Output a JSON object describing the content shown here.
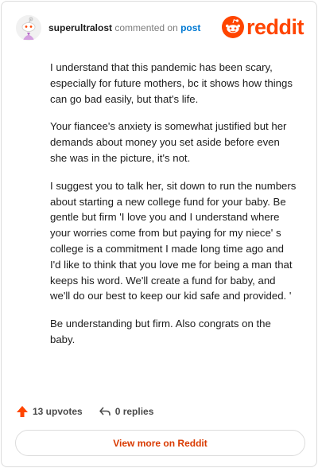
{
  "comment": {
    "author": "superultralost",
    "action_text": "commented on",
    "post_link": "post",
    "paragraphs": [
      "I understand that this pandemic has been scary, especially for future mothers, bc it shows how things can go bad easily, but that's life.",
      "Your fiancee's anxiety is somewhat justified but her demands about money you set aside before even she was in the picture, it's not.",
      "I suggest you to talk her, sit down to run the numbers about starting a new college fund for your baby. Be gentle but firm 'I love you and I understand where your worries come from but paying for my niece' s college is a commitment I made long time ago and I'd like to think that you love me for being a man that keeps his word. We'll create a fund for baby, and we'll do our best to keep our kid safe and provided. '",
      "Be understanding but firm. Also congrats on the baby."
    ]
  },
  "brand": {
    "wordmark": "reddit",
    "color": "#ff4500"
  },
  "footer": {
    "upvotes": "13 upvotes",
    "replies": "0 replies",
    "view_more": "View more on Reddit"
  },
  "icons": {
    "avatar": "snoo-avatar-icon",
    "logo": "reddit-snoo-icon",
    "upvote": "upvote-arrow-icon",
    "reply": "reply-arrow-icon"
  }
}
